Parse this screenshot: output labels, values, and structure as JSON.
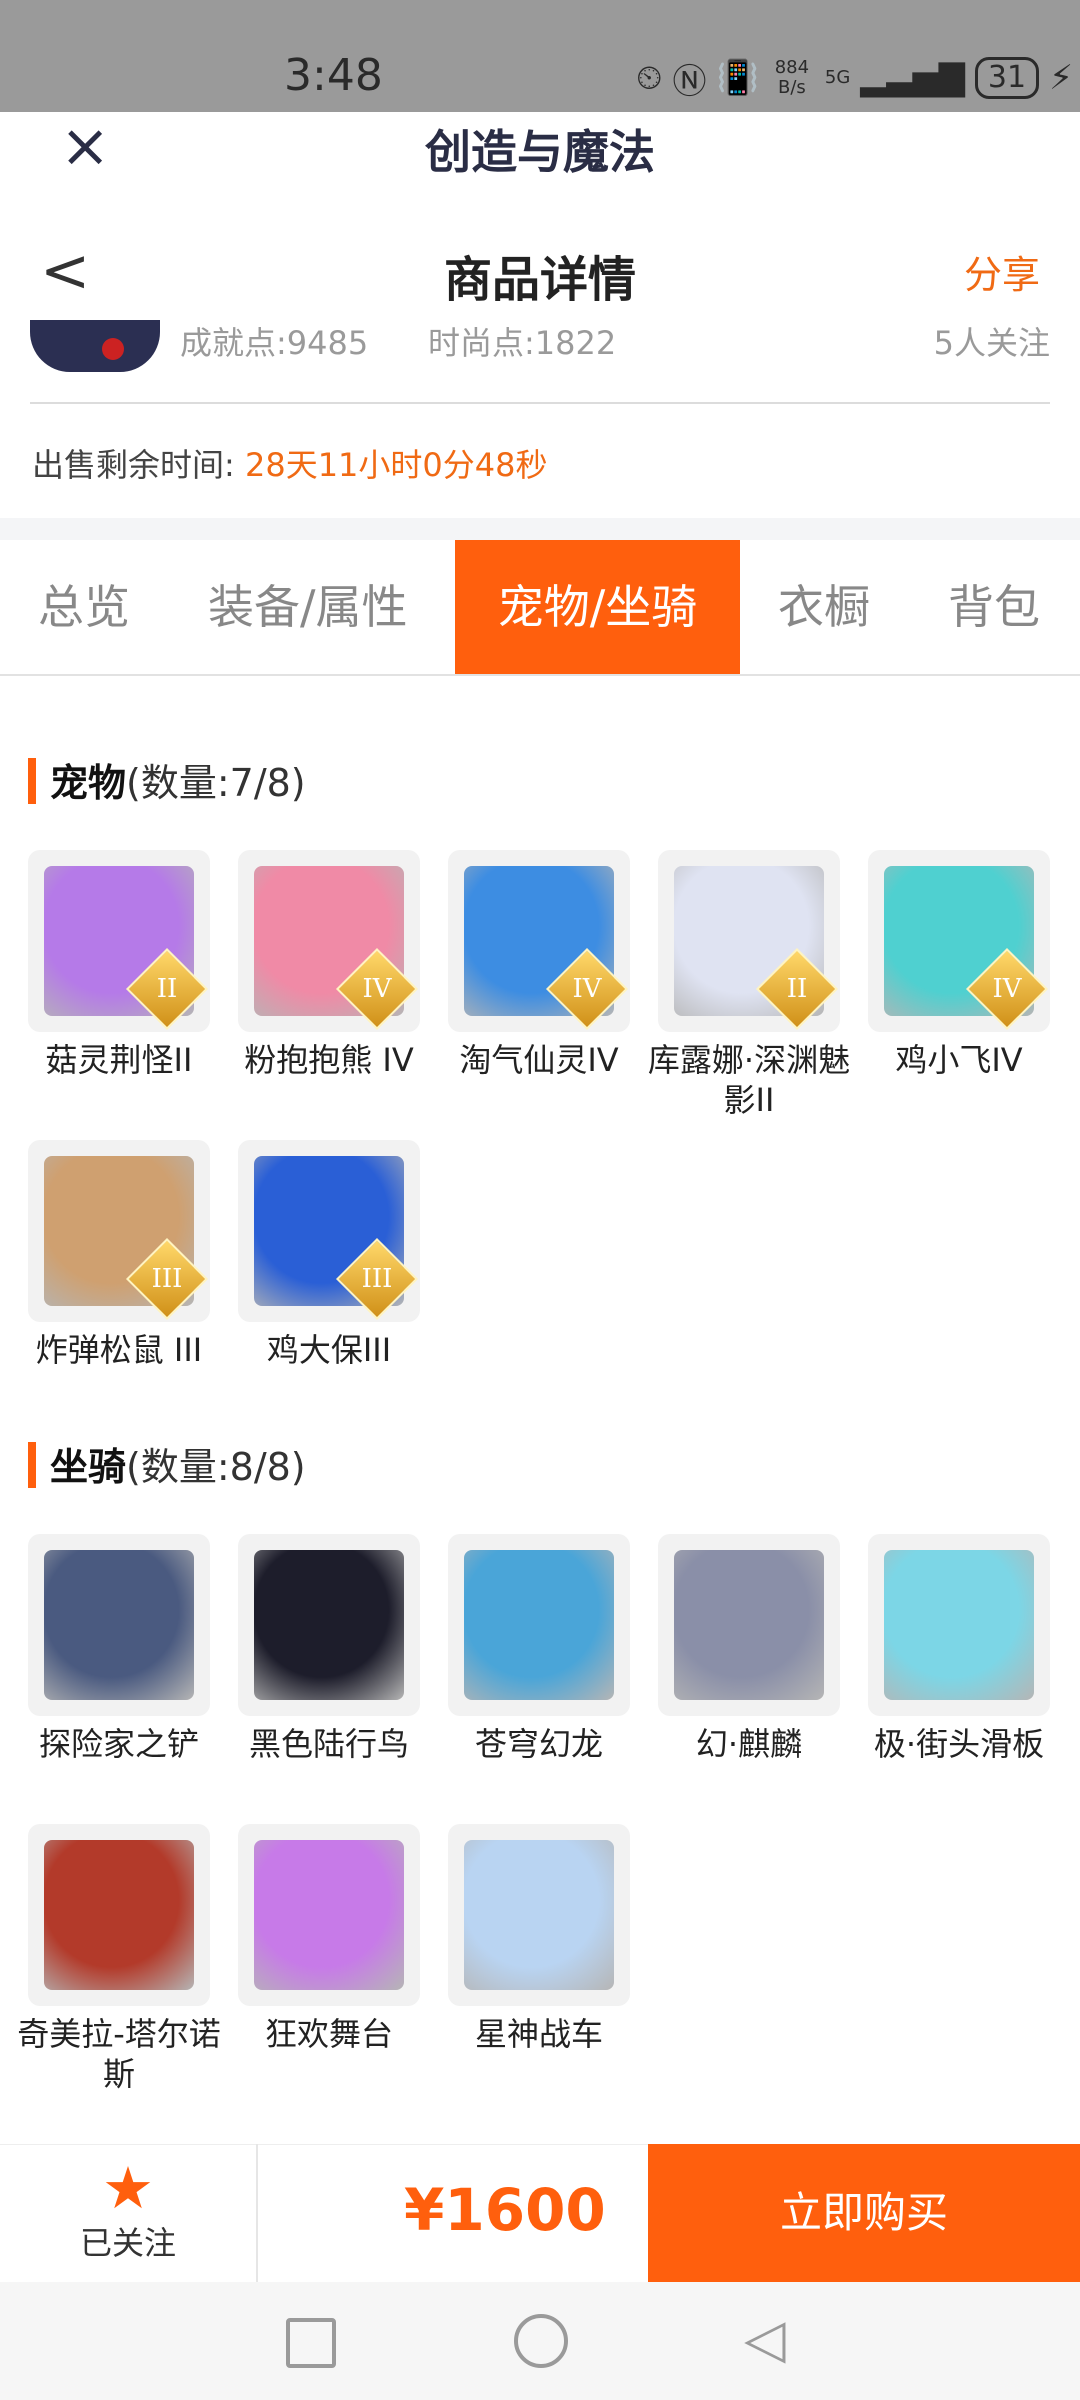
{
  "status_bar": {
    "time": "3:48",
    "net_speed": "884\nB/s",
    "signal": "5G",
    "battery": "31"
  },
  "app_header": {
    "title": "创造与魔法"
  },
  "nav": {
    "title": "商品详情",
    "share": "分享"
  },
  "summary": {
    "achievement": "成就点:9485",
    "fashion": "时尚点:1822",
    "followers": "5人关注",
    "remain_label": "出售剩余时间:",
    "remain_value": "28天11小时0分48秒"
  },
  "tabs": [
    {
      "label": "总览"
    },
    {
      "label": "装备/属性"
    },
    {
      "label": "宠物/坐骑",
      "active": true
    },
    {
      "label": "衣橱"
    },
    {
      "label": "背包"
    }
  ],
  "pets_section": {
    "title": "宠物",
    "count": "(数量:7/8)",
    "items": [
      {
        "name": "菇灵荆怪II",
        "badge": "II",
        "icon": "pet-mushroom-fairy-icon",
        "color": "#b57ae8"
      },
      {
        "name": "粉抱抱熊 IV",
        "badge": "IV",
        "icon": "pet-pink-bear-icon",
        "color": "#f08aa6"
      },
      {
        "name": "淘气仙灵IV",
        "badge": "IV",
        "icon": "pet-blue-dog-icon",
        "color": "#3d8de2"
      },
      {
        "name": "库露娜·深渊魅影II",
        "badge": "II",
        "icon": "pet-white-spirit-icon",
        "color": "#dfe3f2"
      },
      {
        "name": "鸡小飞IV",
        "badge": "IV",
        "icon": "pet-teal-chick-icon",
        "color": "#4fd0d0"
      },
      {
        "name": "炸弹松鼠 III",
        "badge": "III",
        "icon": "pet-squirrel-icon",
        "color": "#cfa070"
      },
      {
        "name": "鸡大保III",
        "badge": "III",
        "icon": "pet-blue-bird-icon",
        "color": "#2a5fd6"
      }
    ]
  },
  "mounts_section": {
    "title": "坐骑",
    "count": "(数量:8/8)",
    "items": [
      {
        "name": "探险家之铲",
        "icon": "mount-shovel-icon",
        "color": "#4a5a80"
      },
      {
        "name": "黑色陆行鸟",
        "icon": "mount-black-bird-icon",
        "color": "#1d1d2b"
      },
      {
        "name": "苍穹幻龙",
        "icon": "mount-sky-dragon-icon",
        "color": "#4aa5d8"
      },
      {
        "name": "幻·麒麟",
        "icon": "mount-qilin-icon",
        "color": "#8a8fa8"
      },
      {
        "name": "极·街头滑板",
        "icon": "mount-skateboard-icon",
        "color": "#7cd6e6"
      },
      {
        "name": "奇美拉-塔尔诺斯",
        "icon": "mount-chimera-icon",
        "color": "#b33a2a"
      },
      {
        "name": "狂欢舞台",
        "icon": "mount-carnival-stage-icon",
        "color": "#c77ae8"
      },
      {
        "name": "星神战车",
        "icon": "mount-star-chariot-icon",
        "color": "#b9d4f2"
      }
    ]
  },
  "bottom_bar": {
    "follow_label": "已关注",
    "price": "¥1600",
    "buy_label": "立即购买"
  },
  "colors": {
    "accent": "#ff5f0d",
    "accent_text": "#f06a14"
  }
}
